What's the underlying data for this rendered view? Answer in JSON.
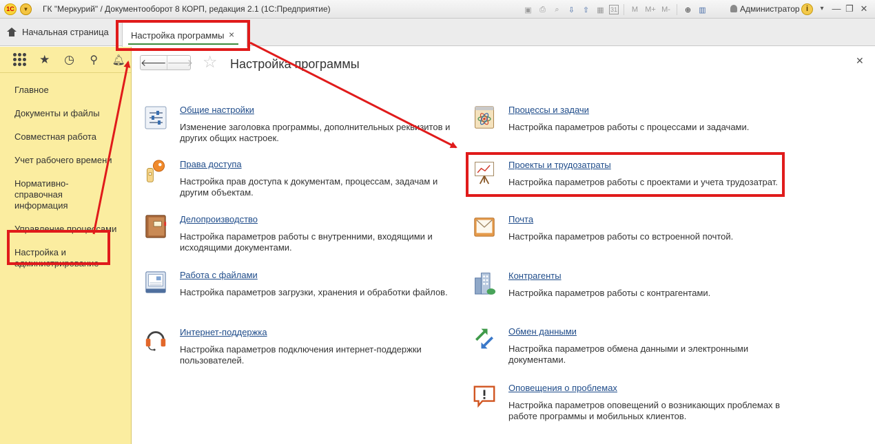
{
  "window": {
    "app_logo": "1С",
    "title": "ГК \"Меркурий\" / Документооборот 8 КОРП, редакция 2.1  (1С:Предприятие)",
    "user": "Администратор",
    "memory_buttons": [
      "M",
      "M+",
      "M-"
    ],
    "calendar_day": "31",
    "info_label": "i"
  },
  "tabs": {
    "home_label": "Начальная страница",
    "active_label": "Настройка программы"
  },
  "sidebar": {
    "items": [
      {
        "label": "Главное"
      },
      {
        "label": "Документы и файлы"
      },
      {
        "label": "Совместная работа"
      },
      {
        "label": "Учет рабочего времени"
      },
      {
        "label": "Нормативно-справочная информация"
      },
      {
        "label": "Управление процессами"
      },
      {
        "label": "Настройка и администрирование"
      }
    ]
  },
  "main": {
    "title": "Настройка программы",
    "left": [
      {
        "link": "Общие настройки",
        "desc": "Изменение заголовка программы, дополнительных реквизитов и других общих настроек.",
        "icon": "sliders-icon"
      },
      {
        "link": "Права доступа",
        "desc": "Настройка прав доступа к документам, процессам, задачам и другим объектам.",
        "icon": "key-icon"
      },
      {
        "link": "Делопроизводство",
        "desc": "Настройка параметров работы с внутренними, входящими и исходящими документами.",
        "icon": "binder-icon"
      },
      {
        "link": "Работа с файлами",
        "desc": "Настройка параметров загрузки, хранения и обработки файлов.",
        "icon": "file-icon"
      },
      {
        "link": "Интернет-поддержка",
        "desc": "Настройка параметров подключения интернет-поддержки пользователей.",
        "icon": "headset-icon"
      }
    ],
    "right": [
      {
        "link": "Процессы и задачи",
        "desc": "Настройка параметров работы с процессами и задачами.",
        "icon": "notepad-atom-icon"
      },
      {
        "link": "Проекты и трудозатраты",
        "desc": "Настройка параметров работы с проектами и учета трудозатрат.",
        "icon": "easel-chart-icon"
      },
      {
        "link": "Почта",
        "desc": "Настройка параметров работы со встроенной почтой.",
        "icon": "envelope-icon"
      },
      {
        "link": "Контрагенты",
        "desc": "Настройка параметров работы с контрагентами.",
        "icon": "building-icon"
      },
      {
        "link": "Обмен данными",
        "desc": "Настройка параметров обмена данными и электронными документами.",
        "icon": "exchange-arrows-icon"
      },
      {
        "link": "Оповещения о проблемах",
        "desc": "Настройка параметров оповещений о возникающих проблемах в работе программы и мобильных клиентов.",
        "icon": "alert-message-icon"
      }
    ]
  },
  "colors": {
    "sidebar_bg": "#fbeda0",
    "link": "#1f4c8a",
    "highlight": "#e01b1b",
    "tab_underline": "#3b8a3b"
  }
}
